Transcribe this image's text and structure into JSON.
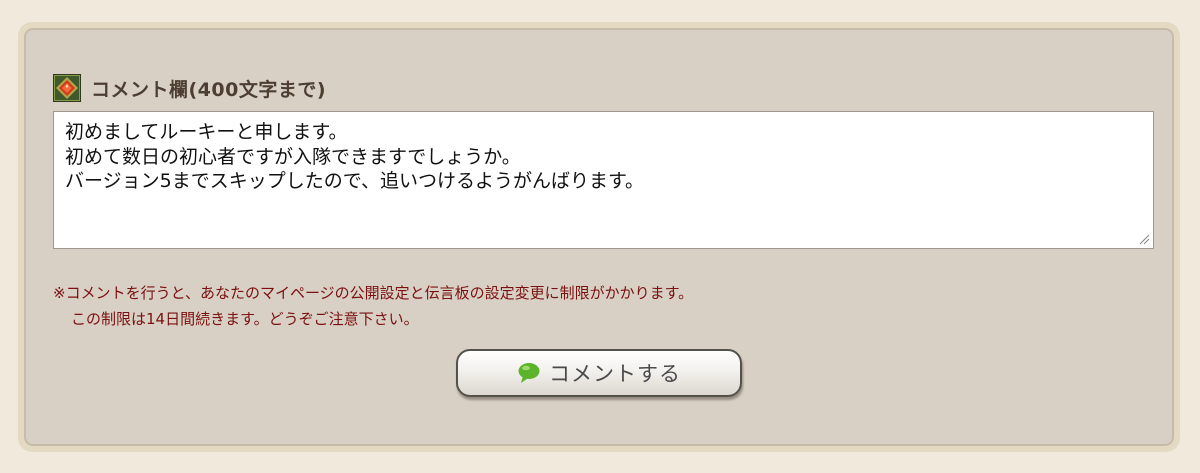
{
  "comment_section": {
    "heading": "コメント欄(400文字まで)",
    "heading_icon": "diamond-emblem-icon",
    "comment_text": "初めましてルーキーと申します。\n初めて数日の初心者ですが入隊できますでしょうか。\nバージョン5までスキップしたので、追いつけるようがんばります。",
    "notice_line1": "※コメントを行うと、あなたのマイページの公開設定と伝言板の設定変更に制限がかかります。",
    "notice_line2": "この制限は14日間続きます。どうぞご注意下さい。",
    "submit_label": "コメントする",
    "submit_icon": "speech-bubble-icon"
  },
  "colors": {
    "page_background": "#f1e9dc",
    "panel_background": "#d8d0c4",
    "notice_text": "#7a1010",
    "bubble_green": "#5cb42b"
  }
}
